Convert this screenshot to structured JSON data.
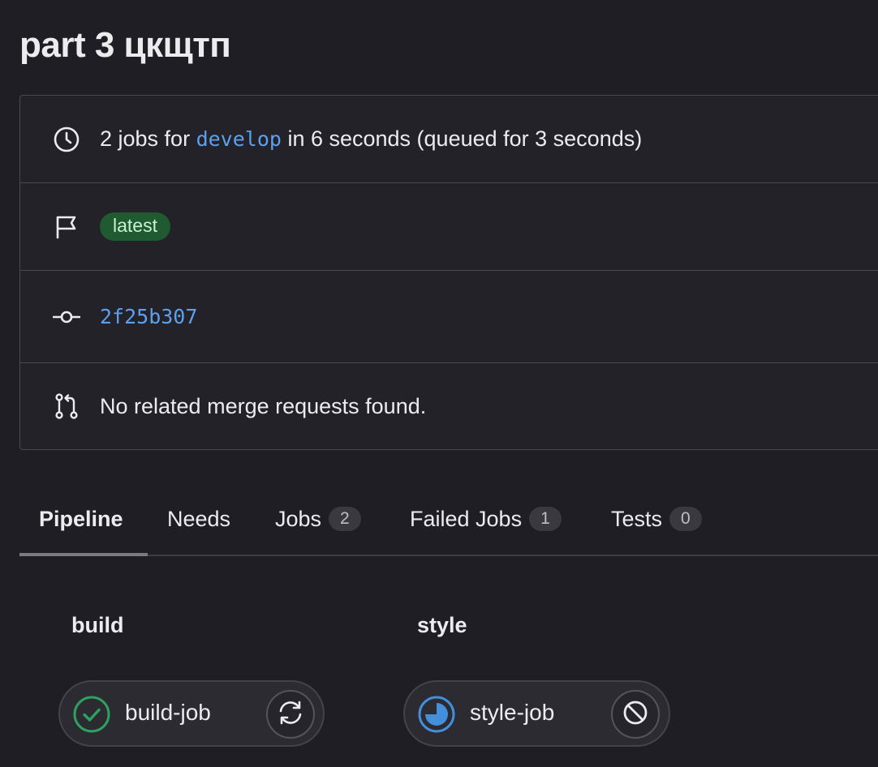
{
  "page": {
    "title": "part 3 цкщтп"
  },
  "info": {
    "jobs_prefix": "2 jobs for",
    "branch": "develop",
    "jobs_suffix": "in 6 seconds (queued for 3 seconds)",
    "badge": "latest",
    "commit_sha": "2f25b307",
    "merge_requests_text": "No related merge requests found."
  },
  "tabs": [
    {
      "label": "Pipeline",
      "count": null,
      "active": true
    },
    {
      "label": "Needs",
      "count": null,
      "active": false
    },
    {
      "label": "Jobs",
      "count": "2",
      "active": false
    },
    {
      "label": "Failed Jobs",
      "count": "1",
      "active": false
    },
    {
      "label": "Tests",
      "count": "0",
      "active": false
    }
  ],
  "stages": [
    {
      "name": "build",
      "jobs": [
        {
          "name": "build-job",
          "status": "passed",
          "status_icon": "check-circle-icon",
          "action_icon": "retry-icon"
        }
      ]
    },
    {
      "name": "style",
      "jobs": [
        {
          "name": "style-job",
          "status": "running",
          "status_icon": "running-icon",
          "action_icon": "cancel-icon"
        }
      ]
    }
  ],
  "colors": {
    "background": "#1f1e24",
    "link": "#5ca0ee",
    "success": "#2da160",
    "running": "#428fdc",
    "badge_bg": "#1f5a30"
  }
}
